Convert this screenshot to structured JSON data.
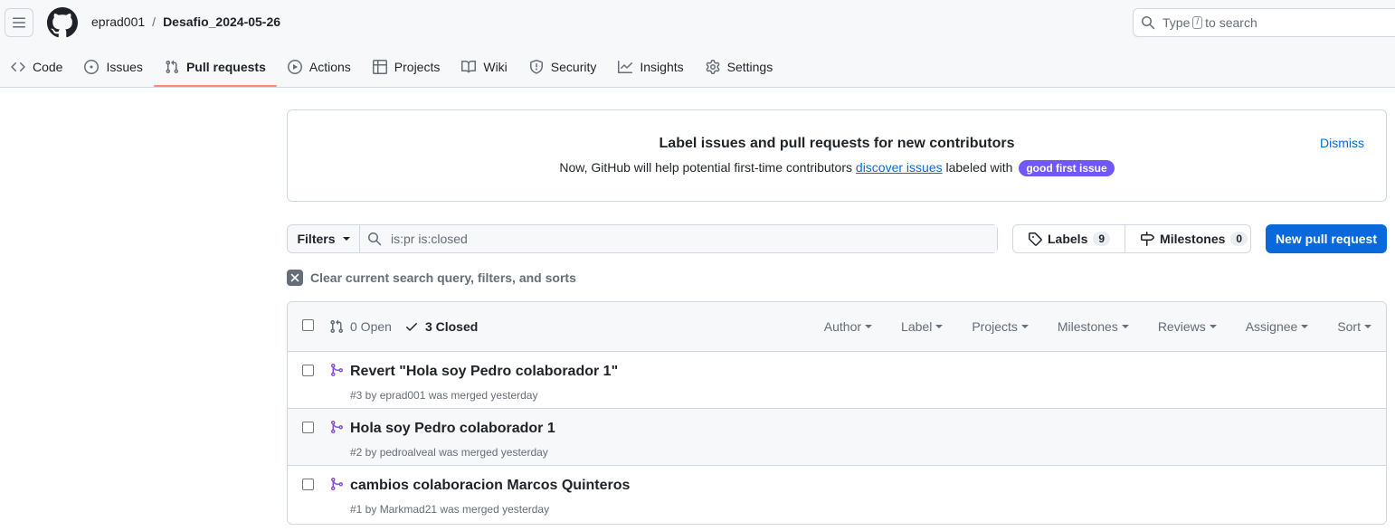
{
  "breadcrumb": {
    "owner": "eprad001",
    "separator": "/",
    "repo": "Desafio_2024-05-26"
  },
  "search": {
    "before": "Type",
    "key": "/",
    "after": "to search"
  },
  "tabs": [
    {
      "label": "Code",
      "icon": "code-icon"
    },
    {
      "label": "Issues",
      "icon": "issue-icon"
    },
    {
      "label": "Pull requests",
      "icon": "pull-request-icon",
      "active": true
    },
    {
      "label": "Actions",
      "icon": "play-icon"
    },
    {
      "label": "Projects",
      "icon": "table-icon"
    },
    {
      "label": "Wiki",
      "icon": "book-icon"
    },
    {
      "label": "Security",
      "icon": "shield-icon"
    },
    {
      "label": "Insights",
      "icon": "graph-icon"
    },
    {
      "label": "Settings",
      "icon": "gear-icon"
    }
  ],
  "banner": {
    "title": "Label issues and pull requests for new contributors",
    "text_before": "Now, GitHub will help potential first-time contributors",
    "link": "discover issues",
    "text_after": "labeled with",
    "label": "good first issue",
    "label_color": "#7057ff",
    "dismiss": "Dismiss"
  },
  "filters": {
    "button": "Filters",
    "query": "is:pr is:closed"
  },
  "labels_btn": {
    "label": "Labels",
    "count": "9"
  },
  "milestones_btn": {
    "label": "Milestones",
    "count": "0"
  },
  "new_pr": {
    "label": "New pull request",
    "color": "#0969da"
  },
  "clear": {
    "label": "Clear current search query, filters, and sorts"
  },
  "list": {
    "open_label": "0 Open",
    "closed_label": "3 Closed",
    "sort_menus": [
      "Author",
      "Label",
      "Projects",
      "Milestones",
      "Reviews",
      "Assignee",
      "Sort"
    ],
    "items": [
      {
        "title": "Revert \"Hola soy Pedro colaborador 1\"",
        "meta": "#3 by eprad001 was merged yesterday"
      },
      {
        "title": "Hola soy Pedro colaborador 1",
        "meta": "#2 by pedroalveal was merged yesterday"
      },
      {
        "title": "cambios colaboracion Marcos Quinteros",
        "meta": "#1 by Markmad21 was merged yesterday"
      }
    ]
  },
  "colors": {
    "merged": "#8250df",
    "accent": "#fd8c73"
  }
}
